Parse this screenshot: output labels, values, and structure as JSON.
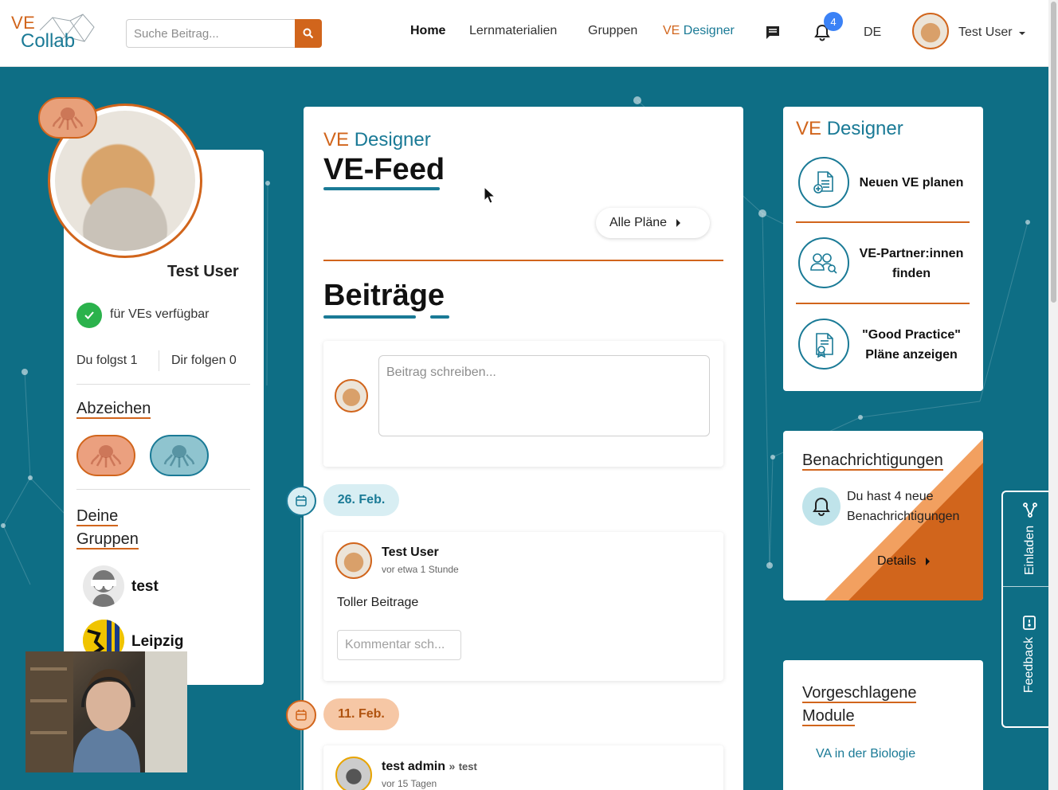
{
  "header": {
    "logo_top": "VE",
    "logo_bottom": "Collab",
    "search_placeholder": "Suche Beitrag...",
    "nav": {
      "home": "Home",
      "lernmaterialien": "Lernmaterialien",
      "gruppen": "Gruppen",
      "ve_designer_prefix": "VE",
      "ve_designer_suffix": "Designer"
    },
    "notification_count": "4",
    "language": "DE",
    "user_name": "Test User"
  },
  "profile": {
    "name": "Test User",
    "availability": "für VEs verfügbar",
    "following": "Du folgst 1",
    "followers": "Dir folgen 0",
    "badges_title": "Abzeichen",
    "groups_title_line1": "Deine",
    "groups_title_line2": "Gruppen",
    "groups": [
      {
        "name": "test"
      },
      {
        "name": "Leipzig"
      }
    ]
  },
  "feed": {
    "section_prefix": "VE",
    "section_suffix": "Designer",
    "title": "VE-Feed",
    "all_plans_button": "Alle Pläne",
    "posts_title": "Beiträge",
    "write_placeholder": "Beitrag schreiben...",
    "dates": [
      "26. Feb.",
      "11. Feb."
    ],
    "posts": [
      {
        "author": "Test User",
        "time": "vor etwa 1 Stunde",
        "body": "Toller Beitrage",
        "comment_placeholder": "Kommentar sch..."
      },
      {
        "author": "test admin",
        "group_arrow": "»",
        "group": "test",
        "time": "vor 15 Tagen"
      }
    ]
  },
  "right": {
    "designer": {
      "title_prefix": "VE",
      "title_suffix": "Designer",
      "items": [
        {
          "label": "Neuen VE planen",
          "icon": "document-plus-icon"
        },
        {
          "label": "VE-Partner:innen finden",
          "icon": "partner-search-icon"
        },
        {
          "label": "\"Good Practice\" Pläne anzeigen",
          "icon": "certificate-icon"
        }
      ]
    },
    "notifications": {
      "title": "Benachrichtigungen",
      "text": "Du hast 4 neue Benachrichtigungen",
      "details": "Details"
    },
    "modules": {
      "title_line1": "Vorgeschlagene",
      "title_line2": "Module",
      "link": "VA in der Biologie"
    }
  },
  "sidetab": {
    "invite": "Einladen",
    "feedback": "Feedback"
  },
  "colors": {
    "brand_orange": "#d1651c",
    "brand_teal": "#1a7a96",
    "background": "#0e6e85",
    "available_green": "#2bb24c",
    "badge_blue": "#3b82f6"
  }
}
